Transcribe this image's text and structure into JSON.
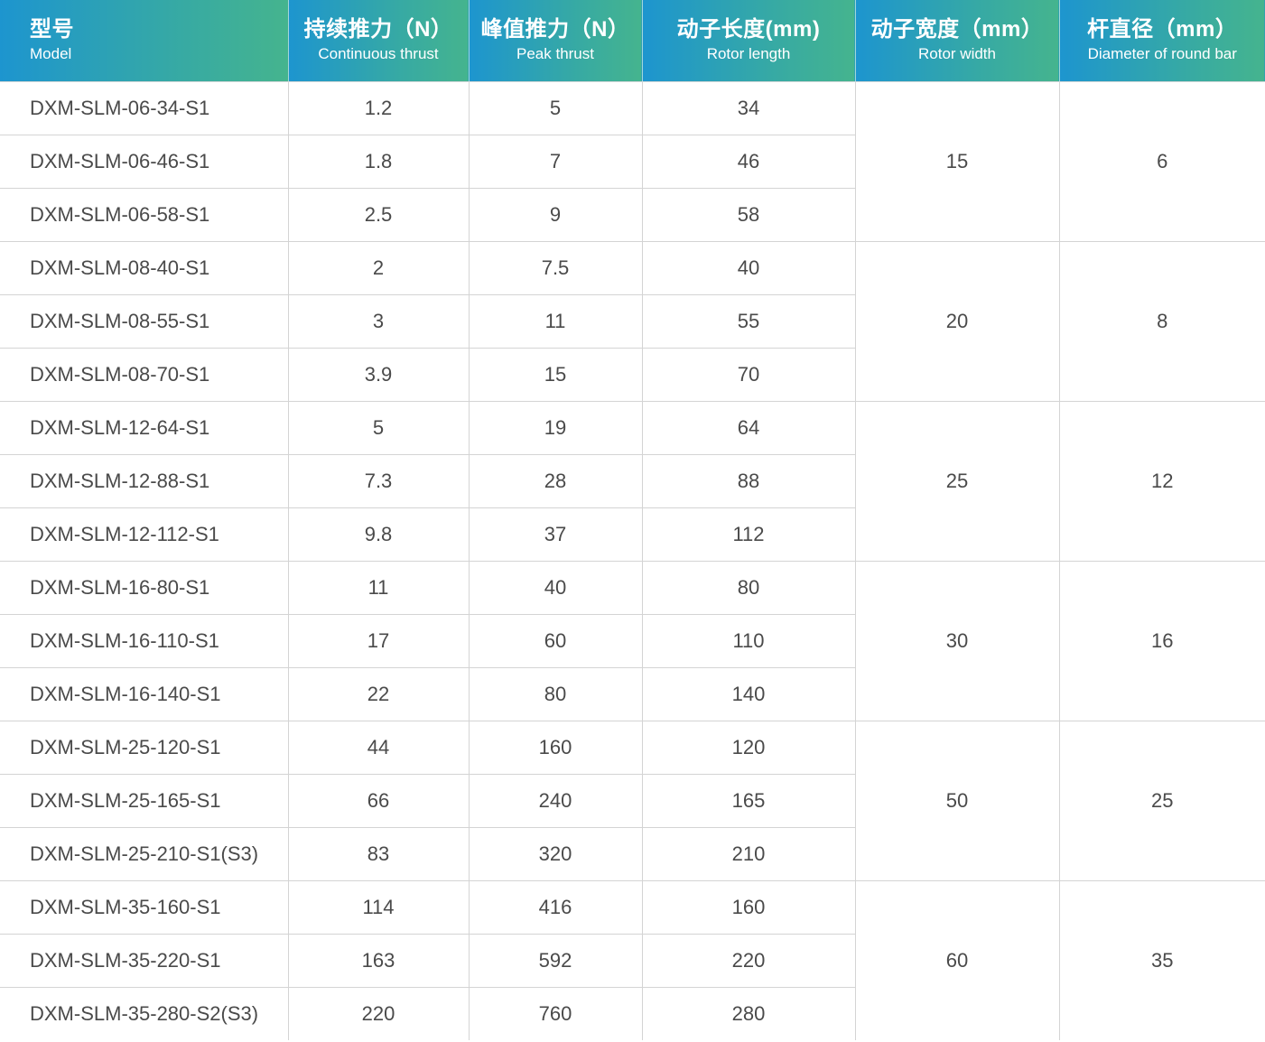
{
  "columns": [
    {
      "zh": "型号",
      "en": "Model"
    },
    {
      "zh": "持续推力（N）",
      "en": "Continuous thrust"
    },
    {
      "zh": "峰值推力（N）",
      "en": "Peak thrust"
    },
    {
      "zh": "动子长度(mm)",
      "en": "Rotor length"
    },
    {
      "zh": "动子宽度（mm）",
      "en": "Rotor width"
    },
    {
      "zh": "杆直径（mm）",
      "en": "Diameter of round bar"
    }
  ],
  "groups": [
    {
      "rotor_width": "15",
      "bar_diameter": "6",
      "rows": [
        {
          "model": "DXM-SLM-06-34-S1",
          "continuous": "1.2",
          "peak": "5",
          "length": "34"
        },
        {
          "model": "DXM-SLM-06-46-S1",
          "continuous": "1.8",
          "peak": "7",
          "length": "46"
        },
        {
          "model": "DXM-SLM-06-58-S1",
          "continuous": "2.5",
          "peak": "9",
          "length": "58"
        }
      ]
    },
    {
      "rotor_width": "20",
      "bar_diameter": "8",
      "rows": [
        {
          "model": "DXM-SLM-08-40-S1",
          "continuous": "2",
          "peak": "7.5",
          "length": "40"
        },
        {
          "model": "DXM-SLM-08-55-S1",
          "continuous": "3",
          "peak": "11",
          "length": "55"
        },
        {
          "model": "DXM-SLM-08-70-S1",
          "continuous": "3.9",
          "peak": "15",
          "length": "70"
        }
      ]
    },
    {
      "rotor_width": "25",
      "bar_diameter": "12",
      "rows": [
        {
          "model": "DXM-SLM-12-64-S1",
          "continuous": "5",
          "peak": "19",
          "length": "64"
        },
        {
          "model": "DXM-SLM-12-88-S1",
          "continuous": "7.3",
          "peak": "28",
          "length": "88"
        },
        {
          "model": "DXM-SLM-12-112-S1",
          "continuous": "9.8",
          "peak": "37",
          "length": "112"
        }
      ]
    },
    {
      "rotor_width": "30",
      "bar_diameter": "16",
      "rows": [
        {
          "model": "DXM-SLM-16-80-S1",
          "continuous": "11",
          "peak": "40",
          "length": "80"
        },
        {
          "model": "DXM-SLM-16-110-S1",
          "continuous": "17",
          "peak": "60",
          "length": "110"
        },
        {
          "model": "DXM-SLM-16-140-S1",
          "continuous": "22",
          "peak": "80",
          "length": "140"
        }
      ]
    },
    {
      "rotor_width": "50",
      "bar_diameter": "25",
      "rows": [
        {
          "model": "DXM-SLM-25-120-S1",
          "continuous": "44",
          "peak": "160",
          "length": "120"
        },
        {
          "model": "DXM-SLM-25-165-S1",
          "continuous": "66",
          "peak": "240",
          "length": "165"
        },
        {
          "model": "DXM-SLM-25-210-S1(S3)",
          "continuous": "83",
          "peak": "320",
          "length": "210"
        }
      ]
    },
    {
      "rotor_width": "60",
      "bar_diameter": "35",
      "rows": [
        {
          "model": "DXM-SLM-35-160-S1",
          "continuous": "114",
          "peak": "416",
          "length": "160"
        },
        {
          "model": "DXM-SLM-35-220-S1",
          "continuous": "163",
          "peak": "592",
          "length": "220"
        },
        {
          "model": "DXM-SLM-35-280-S2(S3)",
          "continuous": "220",
          "peak": "760",
          "length": "280"
        }
      ]
    }
  ]
}
